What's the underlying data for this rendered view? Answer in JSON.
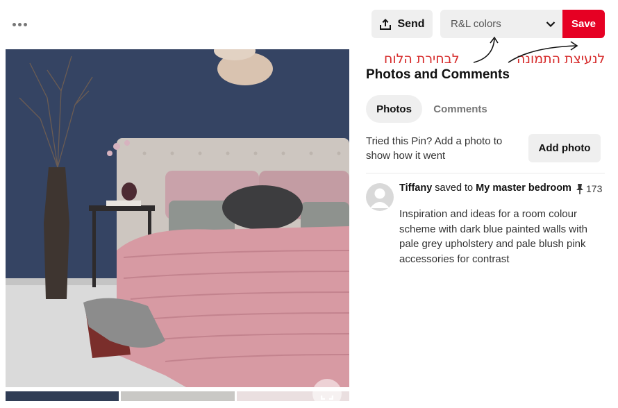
{
  "toolbar": {
    "send_label": "Send",
    "board_value": "R&L colors",
    "save_label": "Save"
  },
  "annotations": {
    "board_select_note": "לבחירת הלוח",
    "pin_image_note": "לנעיצת התמונה"
  },
  "photos_comments": {
    "title": "Photos and Comments",
    "tabs": [
      "Photos",
      "Comments"
    ],
    "tried_text": "Tried this Pin? Add a photo to show how it went",
    "add_photo_label": "Add photo"
  },
  "activity": {
    "user": "Tiffany",
    "verb": " saved to ",
    "board": "My master bedroom",
    "saves_count": "173",
    "description": "Inspiration and ideas for a room colour scheme with dark blue painted walls with pale grey upholstery and pale blush pink accessories for contrast"
  },
  "colors": {
    "accent_red": "#e60023",
    "annotation_red": "#d62a2a",
    "button_grey": "#efefef",
    "swatches": [
      "#303d55",
      "#c9c8c5",
      "#eadfe0"
    ]
  },
  "icons": {
    "more": "more-horizontal-icon",
    "send": "share-upload-icon",
    "chevron": "chevron-down-icon",
    "pin": "pushpin-icon",
    "expand": "expand-icon"
  }
}
